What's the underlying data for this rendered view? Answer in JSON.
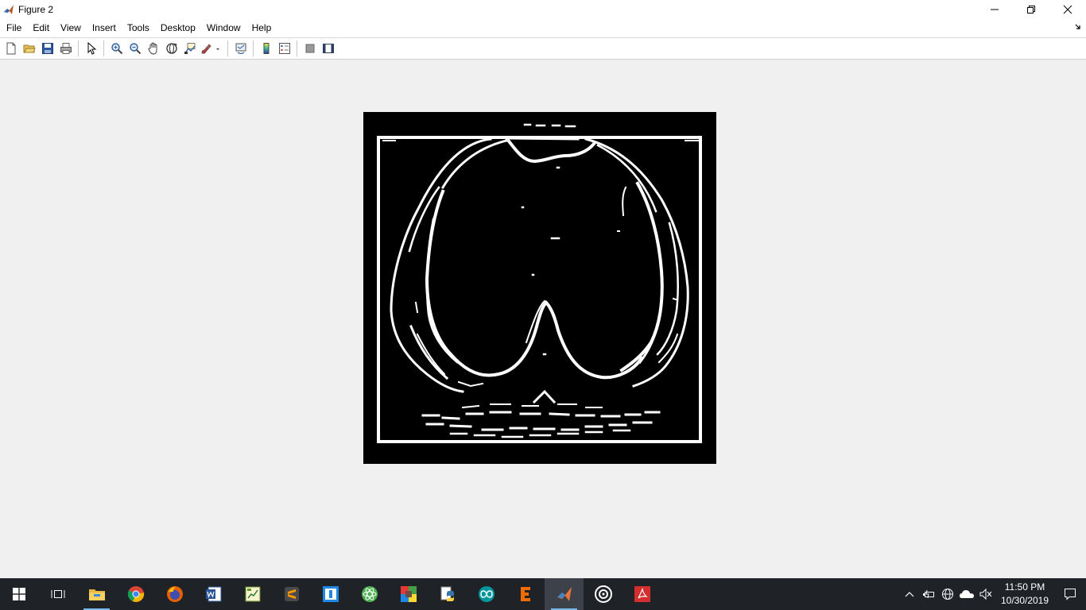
{
  "window": {
    "title": "Figure 2",
    "controls": [
      "minimize-icon",
      "restore-icon",
      "close-icon"
    ]
  },
  "menu": {
    "items": [
      {
        "label": "File"
      },
      {
        "label": "Edit"
      },
      {
        "label": "View"
      },
      {
        "label": "Insert"
      },
      {
        "label": "Tools"
      },
      {
        "label": "Desktop"
      },
      {
        "label": "Window"
      },
      {
        "label": "Help"
      }
    ]
  },
  "toolbar": {
    "buttons": [
      "new-figure-icon",
      "open-file-icon",
      "save-figure-icon",
      "print-figure-icon",
      "edit-plot-icon",
      "zoom-in-icon",
      "zoom-out-icon",
      "pan-icon",
      "rotate-3d-icon",
      "data-cursor-icon",
      "brush-icon",
      "link-plot-icon",
      "insert-colorbar-icon",
      "insert-legend-icon",
      "hide-plot-tools-icon",
      "show-plot-tools-icon"
    ]
  },
  "figure": {
    "image_description_icon": "edge-detected-ct-image",
    "background": "#000000",
    "foreground": "#ffffff"
  },
  "taskbar": {
    "apps": [
      "task-view-icon",
      "file-explorer-icon",
      "chrome-icon",
      "firefox-icon",
      "word-icon",
      "excel-app-icon",
      "sublime-text-icon",
      "app-icon",
      "atom-icon",
      "colorful-app-icon",
      "python-icon",
      "arduino-icon",
      "editor-e-icon",
      "matlab-icon",
      "obs-icon",
      "acrobat-icon"
    ],
    "tray": [
      "chevron-up-icon",
      "battery-icon",
      "network-icon",
      "onedrive-icon",
      "volume-mute-icon"
    ],
    "clock": {
      "time": "11:50 PM",
      "date": "10/30/2019"
    }
  }
}
